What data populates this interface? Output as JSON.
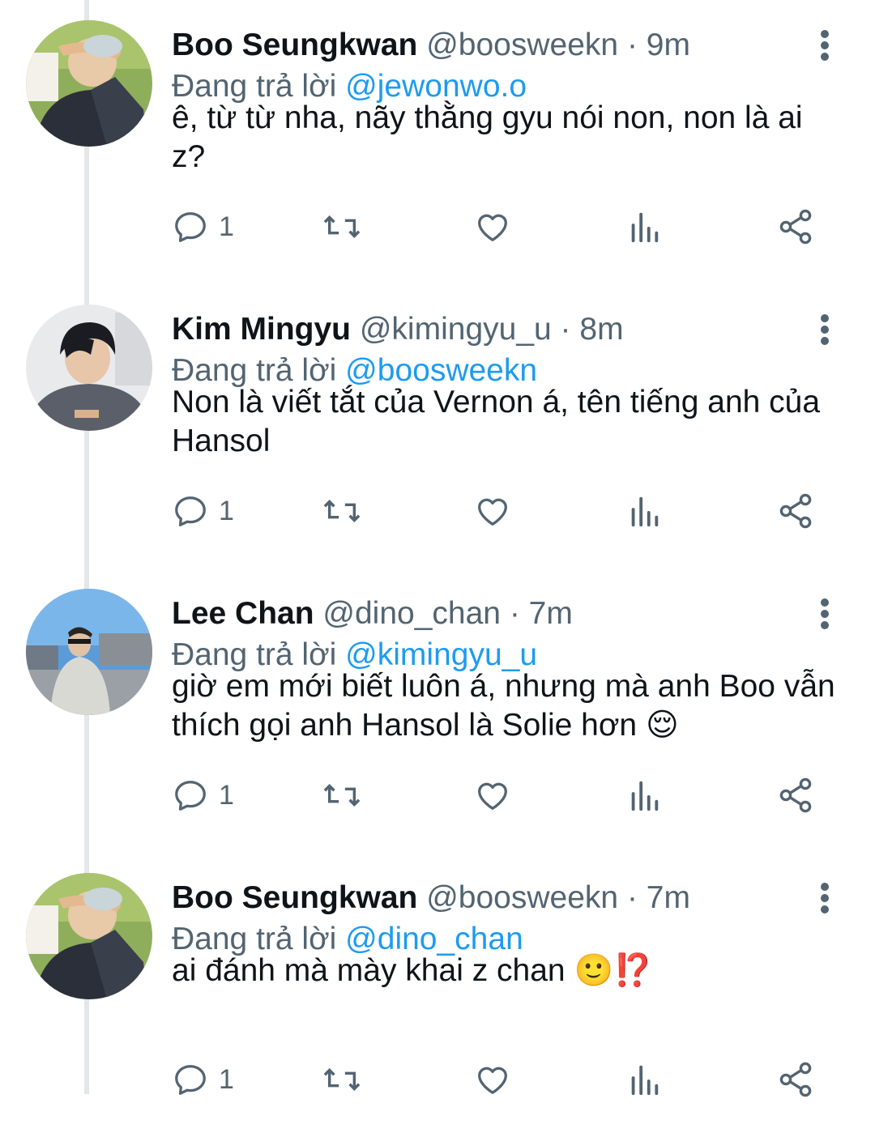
{
  "tweets": [
    {
      "name": "Boo Seungkwan",
      "handle": "@boosweekn",
      "dot": "·",
      "time": "9m",
      "reply_prefix": "Đang trả lời ",
      "reply_to": "@jewonwo.o",
      "text": "ê, từ từ nha, nãy thằng gyu nói non, non là ai z?",
      "emoji": "",
      "reply_count": "1",
      "avatar": "avatar-boo"
    },
    {
      "name": "Kim Mingyu",
      "handle": "@kimingyu_u",
      "dot": "·",
      "time": "8m",
      "reply_prefix": "Đang trả lời ",
      "reply_to": "@boosweekn",
      "text": "Non là viết tắt của Vernon á, tên tiếng anh của Hansol",
      "emoji": "",
      "reply_count": "1",
      "avatar": "avatar-mingyu"
    },
    {
      "name": "Lee Chan",
      "handle": "@dino_chan",
      "dot": "·",
      "time": "7m",
      "reply_prefix": "Đang trả lời ",
      "reply_to": "@kimingyu_u",
      "text": "giờ em mới biết luôn á, nhưng mà anh Boo vẫn thích gọi anh Hansol là Solie hơn ",
      "emoji": "😌",
      "reply_count": "1",
      "avatar": "avatar-chan"
    },
    {
      "name": "Boo Seungkwan",
      "handle": "@boosweekn",
      "dot": "·",
      "time": "7m",
      "reply_prefix": "Đang trả lời ",
      "reply_to": "@dino_chan",
      "text": "ai đánh mà mày khai z chan ",
      "emoji": "🙂⁉️",
      "reply_count": "1",
      "avatar": "avatar-boo"
    }
  ],
  "icons": {
    "reply": "comment-icon",
    "retweet": "retweet-icon",
    "like": "heart-icon",
    "views": "analytics-icon",
    "share": "share-icon",
    "more": "more-vertical-icon"
  },
  "colors": {
    "text": "#0f1419",
    "secondary": "#536471",
    "mention": "#1d9bf0",
    "thread_line": "#e4e6e8"
  }
}
